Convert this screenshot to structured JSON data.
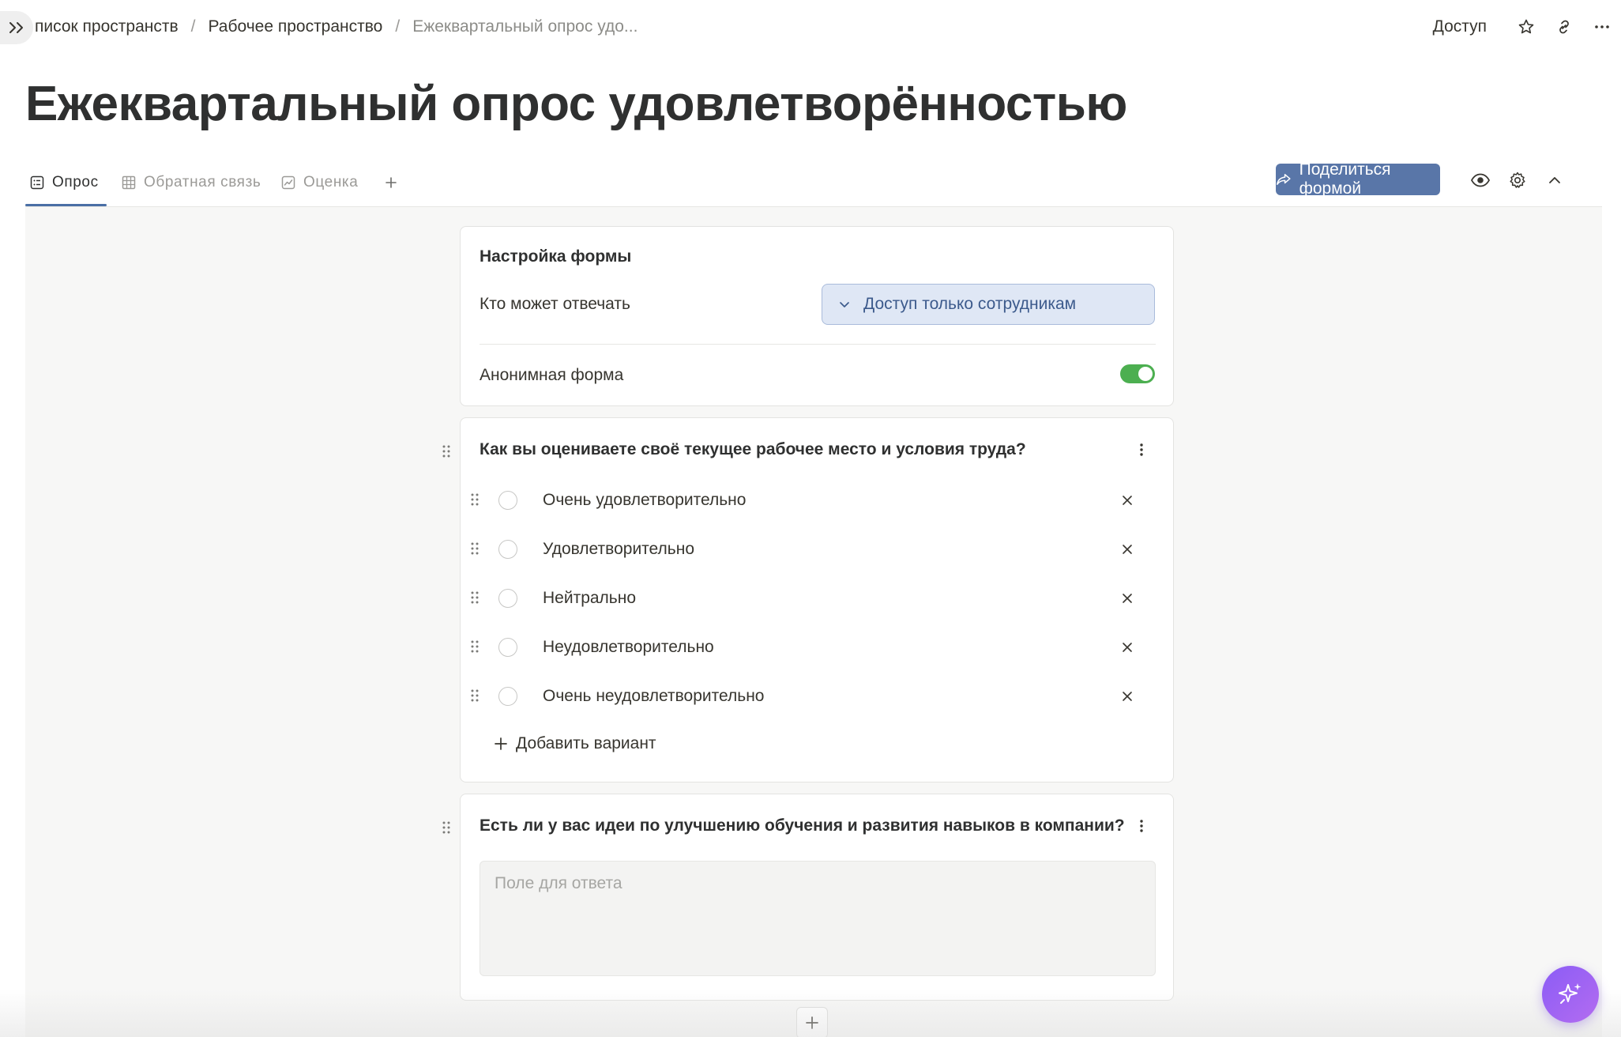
{
  "breadcrumb": {
    "items": [
      "писок пространств",
      "Рабочее пространство",
      "Ежеквартальный опрос удо..."
    ],
    "separator": "/"
  },
  "header": {
    "access_label": "Доступ",
    "icons": [
      "sidebar-expand-icon",
      "star-icon",
      "link-icon",
      "more-horizontal-icon"
    ]
  },
  "page": {
    "title": "Ежеквартальный опрос удовлетворённостью"
  },
  "tabs": [
    {
      "label": "Опрос",
      "icon": "form-icon",
      "active": true
    },
    {
      "label": "Обратная связь",
      "icon": "table-icon",
      "active": false
    },
    {
      "label": "Оценка",
      "icon": "chart-icon",
      "active": false
    }
  ],
  "toolbar": {
    "share_label": "Поделиться формой",
    "icons": [
      "eye-icon",
      "gear-icon",
      "chevron-up-icon"
    ]
  },
  "settings": {
    "title": "Настройка формы",
    "who_can_answer_label": "Кто может отвечать",
    "who_can_answer_value": "Доступ только сотрудникам",
    "anonymous_label": "Анонимная форма",
    "anonymous_enabled": true
  },
  "questions": [
    {
      "title": "Как вы оцениваете своё текущее рабочее место и условия труда?",
      "type": "single-choice",
      "options": [
        "Очень удовлетворительно",
        "Удовлетворительно",
        "Нейтрально",
        "Неудовлетворительно",
        "Очень неудовлетворительно"
      ],
      "add_option_label": "Добавить вариант"
    },
    {
      "title": "Есть ли у вас идеи по улучшению обучения и развития навыков в компании?",
      "type": "text",
      "placeholder": "Поле для ответа"
    }
  ],
  "colors": {
    "accent": "#5976a8",
    "toggle_on": "#4caf50",
    "select_bg": "#dfe7f5",
    "ai_button": "#8b5cf6"
  }
}
